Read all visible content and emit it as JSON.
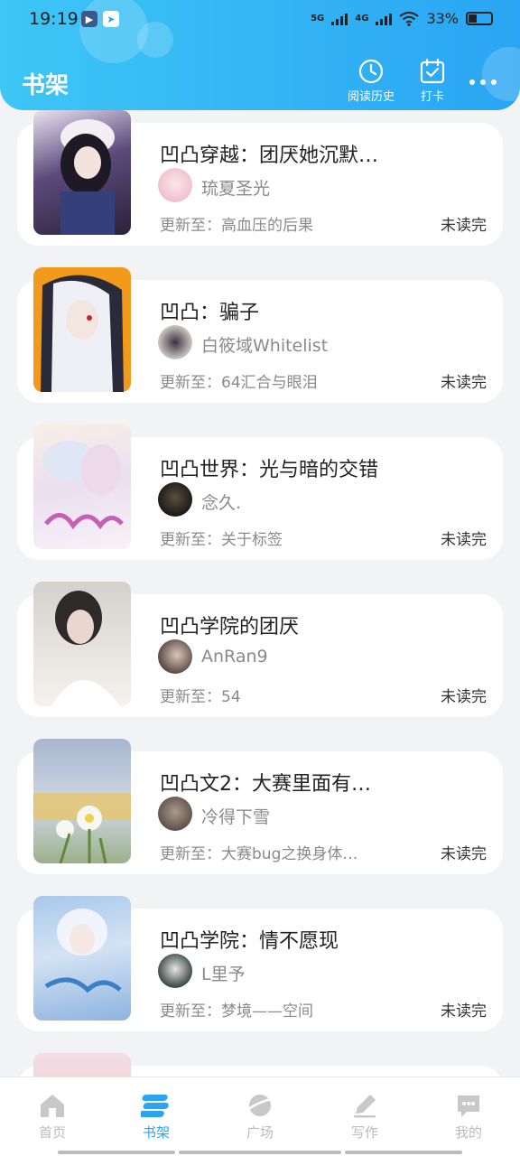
{
  "status_bar": {
    "time": "19:19",
    "network1": "5G",
    "network2": "4G",
    "battery": "33%"
  },
  "header": {
    "title": "书架",
    "history_label": "阅读历史",
    "checkin_label": "打卡"
  },
  "books": [
    {
      "title": "凹凸穿越：团厌她沉默…",
      "author": "琉夏圣光",
      "update": "更新至：高血压的后果",
      "status": "未读完"
    },
    {
      "title": "凹凸：骗子",
      "author": "白筱域Whitelist",
      "update": "更新至：64汇合与眼泪",
      "status": "未读完"
    },
    {
      "title": "凹凸世界：光与暗的交错",
      "author": "念久.",
      "update": "更新至：关于标签",
      "status": "未读完"
    },
    {
      "title": "凹凸学院的团厌",
      "author": "AnRan9",
      "update": "更新至：54",
      "status": "未读完"
    },
    {
      "title": "凹凸文2：大赛里面有…",
      "author": "冷得下雪",
      "update": "更新至：大赛bug之换身体…",
      "status": "未读完"
    },
    {
      "title": "凹凸学院：情不愿现",
      "author": "L里予",
      "update": "更新至：梦境——空间",
      "status": "未读完"
    }
  ],
  "tabbar": {
    "home": "首页",
    "shelf": "书架",
    "plaza": "广场",
    "write": "写作",
    "mine": "我的"
  },
  "colors": {
    "accent": "#2aa5f3",
    "header_start": "#3ec6f6",
    "header_end": "#2aa5f3"
  }
}
